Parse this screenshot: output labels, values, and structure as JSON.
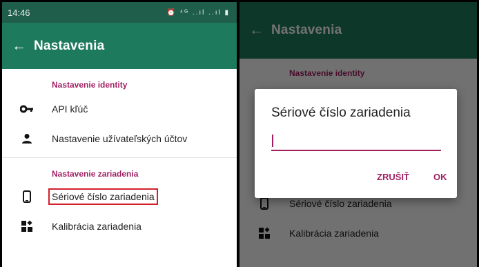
{
  "left": {
    "status": {
      "time": "14:46",
      "icons": "⏰ ⁴ᴳ ..ıl ..ıl ▮"
    },
    "toolbar": {
      "title": "Nastavenia"
    },
    "identity": {
      "header": "Nastavenie identity",
      "items": [
        {
          "label": "API kľúč",
          "icon": "key-icon"
        },
        {
          "label": "Nastavenie užívateľských účtov",
          "icon": "person-icon"
        }
      ]
    },
    "device": {
      "header": "Nastavenie zariadenia",
      "items": [
        {
          "label": "Sériové číslo zariadenia",
          "icon": "phone-icon"
        },
        {
          "label": "Kalibrácia zariadenia",
          "icon": "widgets-icon"
        }
      ]
    }
  },
  "right": {
    "toolbar": {
      "title": "Nastavenia"
    },
    "identity": {
      "header": "Nastavenie identity"
    },
    "device": {
      "items": [
        {
          "label": "Sériové číslo zariadenia"
        },
        {
          "label": "Kalibrácia zariadenia"
        }
      ]
    },
    "dialog": {
      "title": "Sériové číslo zariadenia",
      "input_value": "",
      "cancel": "ZRUŠIŤ",
      "ok": "OK"
    }
  },
  "colors": {
    "toolbar": "#1e7a5c",
    "statusbar": "#1f5e4b",
    "accent": "#a01f62",
    "highlight": "#d21f2a"
  }
}
